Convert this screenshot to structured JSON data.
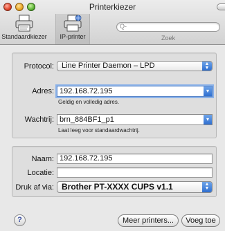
{
  "window": {
    "title": "Printerkiezer"
  },
  "toolbar": {
    "default_browser_label": "Standaardkiezer",
    "ip_printer_label": "IP-printer",
    "search_placeholder": "Q-",
    "search_caption": "Zoek"
  },
  "ip_settings": {
    "protocol_label": "Protocol:",
    "protocol_value": "Line Printer Daemon – LPD",
    "address_label": "Adres:",
    "address_value": "192.168.72.195",
    "address_hint": "Geldig en volledig adres.",
    "queue_label": "Wachtrij:",
    "queue_value": "brn_884BF1_p1",
    "queue_hint": "Laat leeg voor standaardwachtrij."
  },
  "printer_details": {
    "name_label": "Naam:",
    "name_value": "192.168.72.195",
    "location_label": "Locatie:",
    "location_value": "",
    "print_using_label": "Druk af via:",
    "print_using_value": "Brother PT-XXXX CUPS v1.1"
  },
  "footer": {
    "help_label": "?",
    "more_printers_label": "Meer printers...",
    "add_label": "Voeg toe"
  }
}
